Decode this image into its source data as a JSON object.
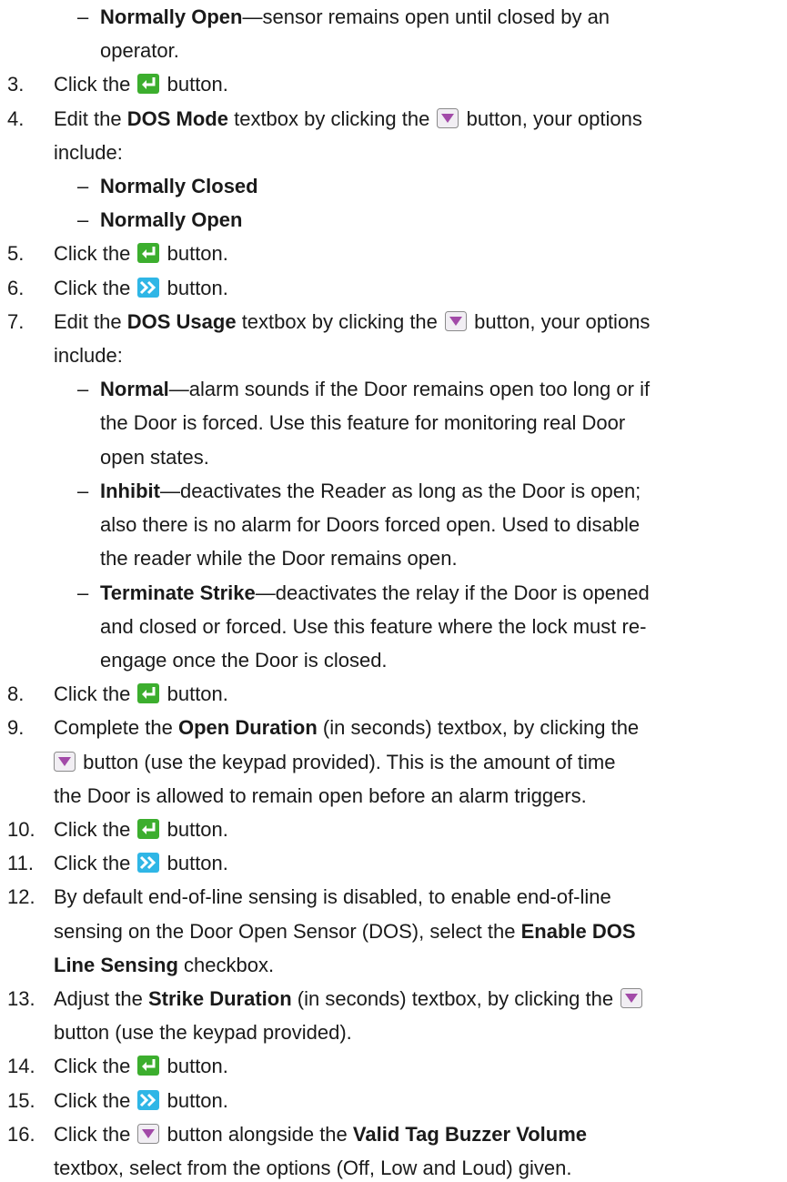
{
  "icons": {
    "enter": "enter-arrow-icon",
    "next": "double-chevron-right-icon",
    "dropdown": "dropdown-triangle-icon"
  },
  "colors": {
    "enter_green": "#3cae2e",
    "next_blue": "#2fb6e6",
    "dropdown_purple": "#a24aa8"
  },
  "items": {
    "cont_normally_open_label": "Normally Open",
    "cont_normally_open_rest_1": "—sensor remains open until closed by an",
    "cont_normally_open_rest_2": "operator.",
    "s3": {
      "num": "3.",
      "pre": "Click the",
      "post": "button."
    },
    "s4": {
      "num": "4.",
      "pre": "Edit the",
      "bold": "DOS Mode",
      "mid": "textbox by clicking the",
      "post": "button, your options",
      "line2": "include:",
      "opt1": "Normally Closed",
      "opt2": "Normally Open"
    },
    "s5": {
      "num": "5.",
      "pre": "Click the",
      "post": "button."
    },
    "s6": {
      "num": "6.",
      "pre": "Click the",
      "post": "button."
    },
    "s7": {
      "num": "7.",
      "pre": "Edit the",
      "bold": "DOS Usage",
      "mid": "textbox by clicking the",
      "post": "button, your options",
      "line2": "include:",
      "normal_label": "Normal",
      "normal_1": "—alarm sounds if the Door remains open too long or if",
      "normal_2": "the Door is forced.  Use this feature for monitoring real Door",
      "normal_3": "open states.",
      "inhibit_label": "Inhibit",
      "inhibit_1": "—deactivates the Reader as long as the Door is open;",
      "inhibit_2": "also there is no alarm for Doors forced open.  Used to disable",
      "inhibit_3": "the reader while the Door remains open.",
      "terminate_label": "Terminate Strike",
      "terminate_1": "—deactivates the relay if the Door is opened",
      "terminate_2": "and closed or forced.  Use this feature where the lock must re-",
      "terminate_3": "engage once the Door is closed."
    },
    "s8": {
      "num": "8.",
      "pre": "Click the",
      "post": "button."
    },
    "s9": {
      "num": "9.",
      "pre": "Complete the",
      "bold": "Open Duration",
      "mid": "(in seconds) textbox, by clicking the",
      "line2_post": "button (use the keypad provided).  This is the amount of time",
      "line3": "the Door is allowed to remain open before an alarm triggers."
    },
    "s10": {
      "num": "10.",
      "pre": "Click the",
      "post": "button."
    },
    "s11": {
      "num": "11.",
      "pre": "Click the",
      "post": "button."
    },
    "s12": {
      "num": "12.",
      "line1": "By default end-of-line sensing is disabled, to enable end-of-line",
      "line2_pre": "sensing on the Door Open Sensor (DOS), select the",
      "line2_bold": "Enable DOS",
      "line3_bold": "Line Sensing",
      "line3_post": "checkbox."
    },
    "s13": {
      "num": "13.",
      "pre": "Adjust the",
      "bold": "Strike Duration",
      "mid": "(in seconds) textbox, by clicking the",
      "line2": "button (use the keypad provided)."
    },
    "s14": {
      "num": "14.",
      "pre": "Click the",
      "post": "button."
    },
    "s15": {
      "num": "15.",
      "pre": "Click the",
      "post": "button."
    },
    "s16": {
      "num": "16.",
      "pre": "Click the",
      "mid": "button alongside the",
      "bold": "Valid Tag Buzzer Volume",
      "line2": "textbox, select from the options (Off, Low and Loud) given."
    }
  }
}
